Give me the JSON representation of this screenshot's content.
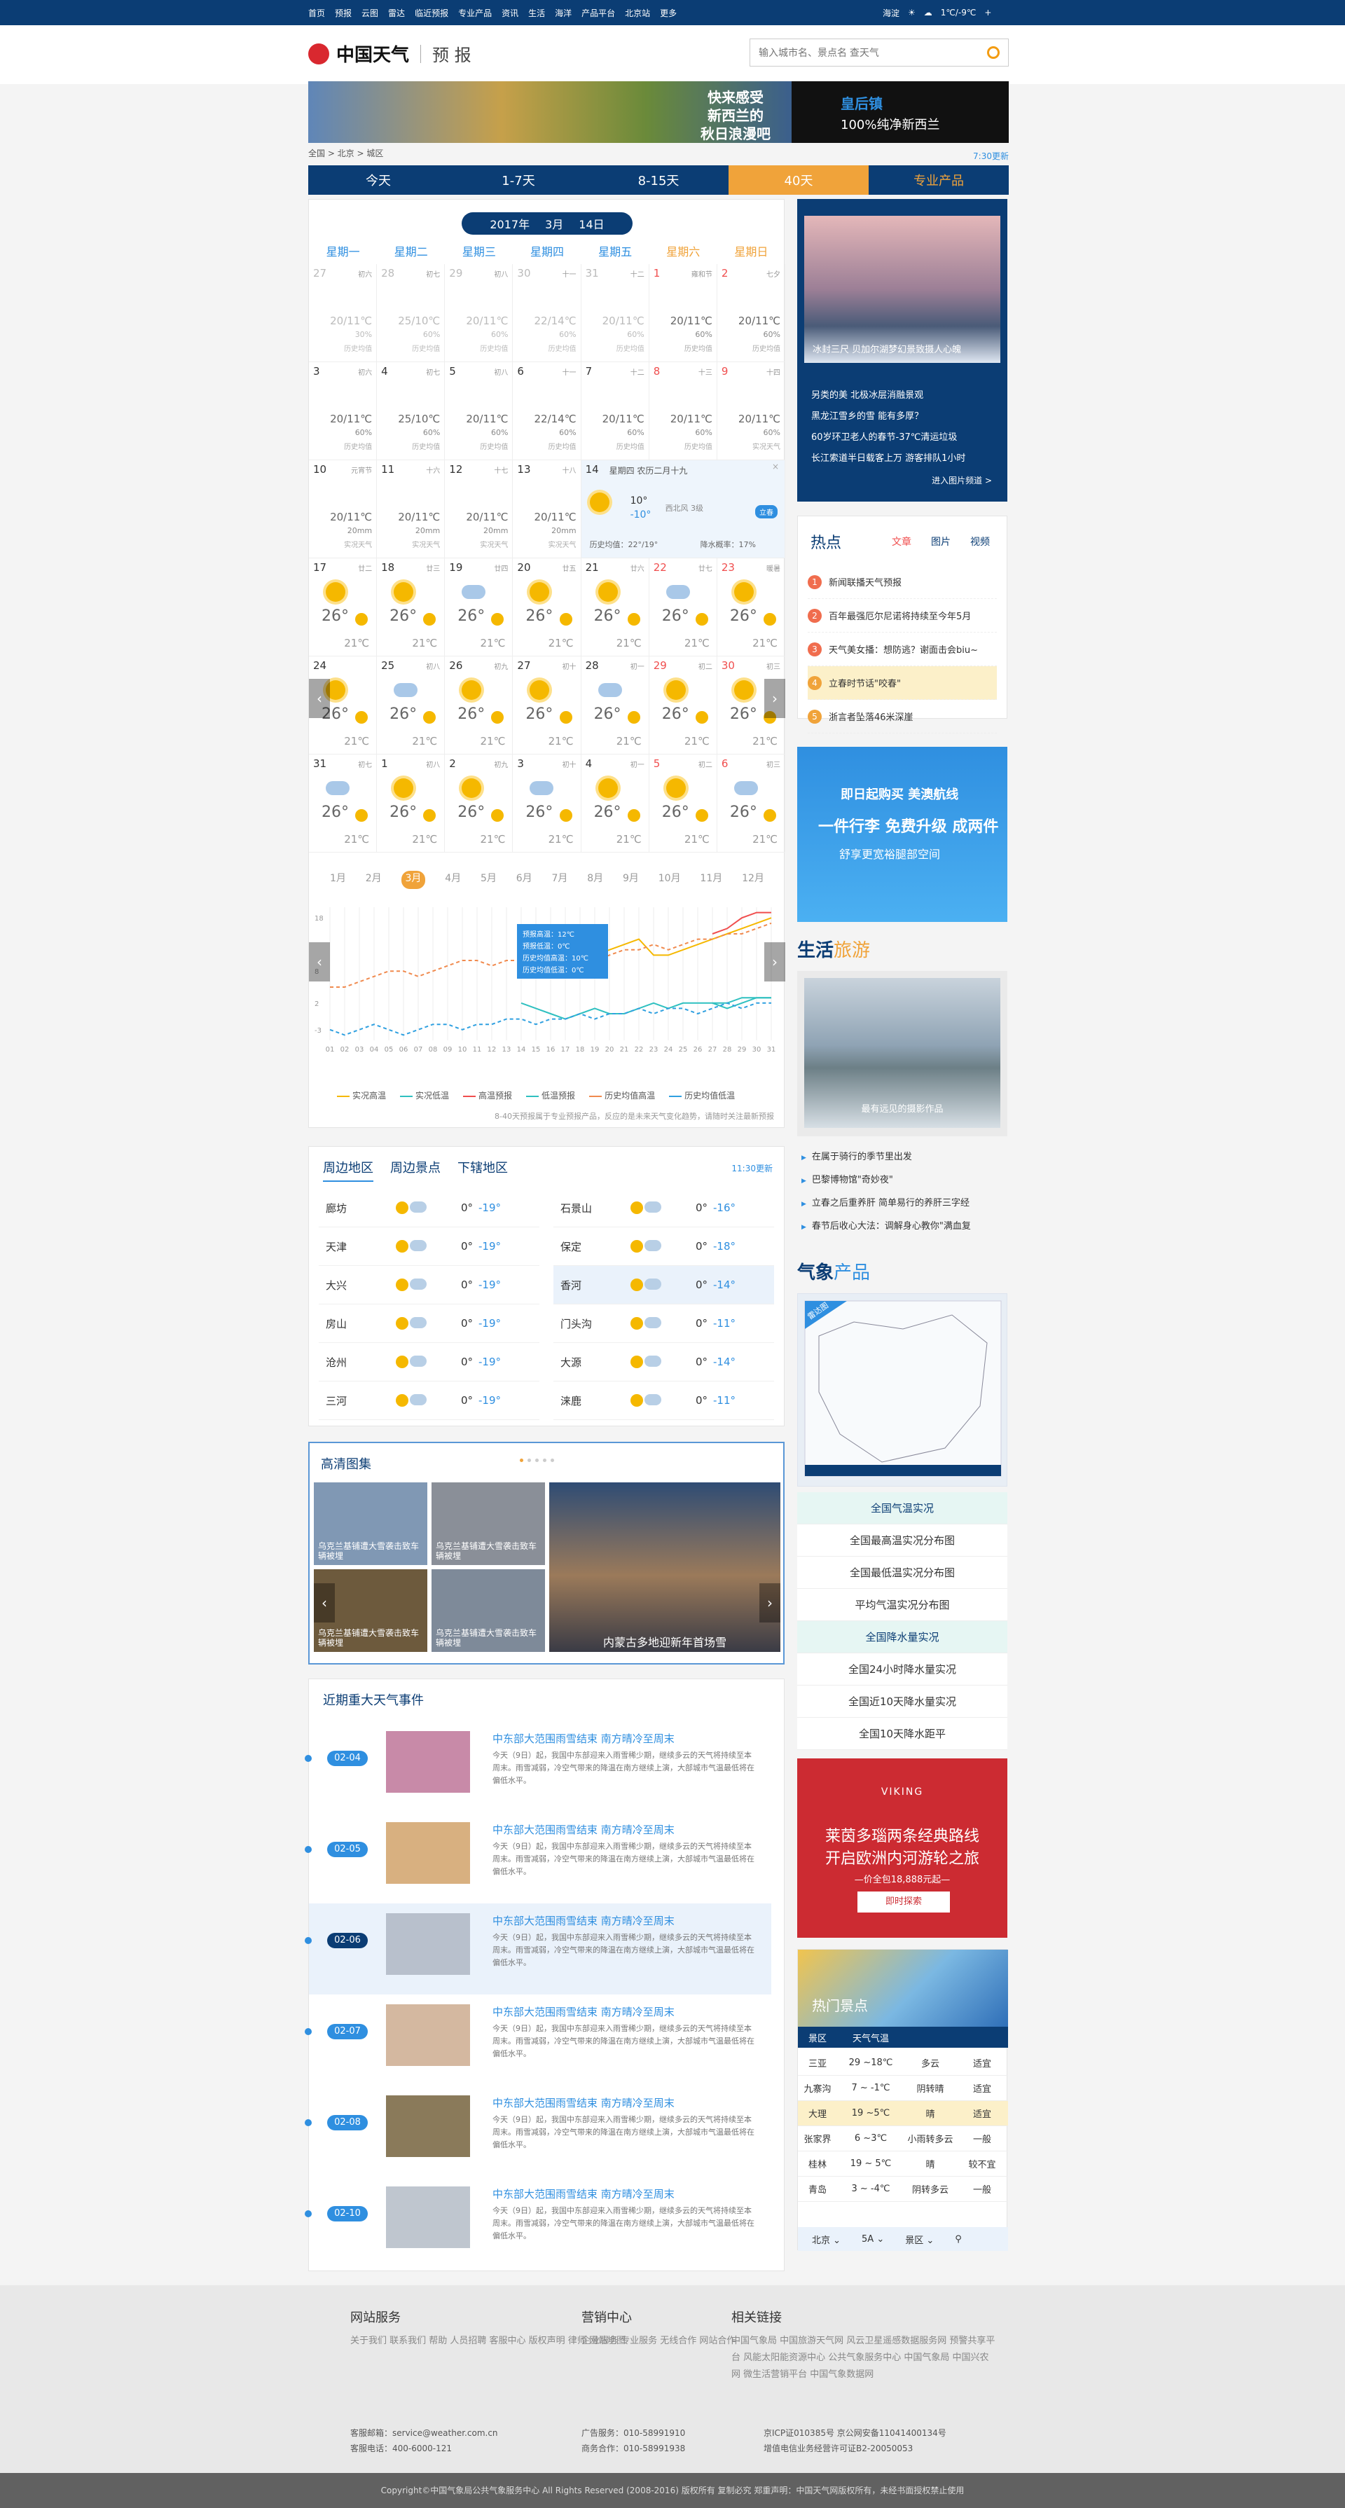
{
  "topbar": {
    "nav": [
      "首页",
      "预报",
      "云图",
      "雷达",
      "临近预报",
      "专业产品",
      "资讯",
      "生活",
      "海洋",
      "产品平台",
      "北京站",
      "更多"
    ],
    "city": "海淀",
    "temp": "1℃/-9℃"
  },
  "header": {
    "brand": "中国天气",
    "sub": "预 报",
    "search_placeholder": "输入城市名、景点名 查天气"
  },
  "banner": {
    "a": "快来感受\n新西兰的\n秋日浪漫吧",
    "b1": "皇后镇",
    "b2": "100%纯净新西兰"
  },
  "crumb": {
    "path": "全国 > 北京 > 城区",
    "time": "7:30更新"
  },
  "tabs": [
    "今天",
    "1-7天",
    "8-15天",
    "40天",
    "专业产品"
  ],
  "calendar": {
    "year": "2017年",
    "month": "3月",
    "day": "14日",
    "weekdays": [
      "星期一",
      "星期二",
      "星期三",
      "星期四",
      "星期五",
      "星期六",
      "星期日"
    ],
    "cells": [
      {
        "d": "27",
        "l": "初六",
        "t": "20/11℃",
        "p": "30%",
        "h": "历史均值",
        "prev": true
      },
      {
        "d": "28",
        "l": "初七",
        "t": "25/10℃",
        "p": "60%",
        "h": "历史均值",
        "prev": true
      },
      {
        "d": "29",
        "l": "初八",
        "t": "20/11℃",
        "p": "60%",
        "h": "历史均值",
        "prev": true
      },
      {
        "d": "30",
        "l": "十一",
        "t": "22/14℃",
        "p": "60%",
        "h": "历史均值",
        "prev": true
      },
      {
        "d": "31",
        "l": "十二",
        "t": "20/11℃",
        "p": "60%",
        "h": "历史均值",
        "prev": true
      },
      {
        "d": "1",
        "l": "雍和节",
        "t": "20/11℃",
        "p": "60%",
        "h": "历史均值"
      },
      {
        "d": "2",
        "l": "七夕",
        "t": "20/11℃",
        "p": "60%",
        "h": "历史均值"
      },
      {
        "d": "3",
        "l": "初六",
        "t": "20/11℃",
        "p": "60%",
        "h": "历史均值"
      },
      {
        "d": "4",
        "l": "初七",
        "t": "25/10℃",
        "p": "60%",
        "h": "历史均值"
      },
      {
        "d": "5",
        "l": "初八",
        "t": "20/11℃",
        "p": "60%",
        "h": "历史均值"
      },
      {
        "d": "6",
        "l": "十一",
        "t": "22/14℃",
        "p": "60%",
        "h": "历史均值"
      },
      {
        "d": "7",
        "l": "十二",
        "t": "20/11℃",
        "p": "60%",
        "h": "历史均值"
      },
      {
        "d": "8",
        "l": "十三",
        "t": "20/11℃",
        "p": "60%",
        "h": "历史均值"
      },
      {
        "d": "9",
        "l": "十四",
        "t": "20/11℃",
        "p": "60%",
        "h": "实况天气"
      },
      {
        "d": "10",
        "l": "元宵节",
        "t": "20/11℃",
        "p": "20mm",
        "h": "实况天气"
      },
      {
        "d": "11",
        "l": "十六",
        "t": "20/11℃",
        "p": "20mm",
        "h": "实况天气"
      },
      {
        "d": "12",
        "l": "十七",
        "t": "20/11℃",
        "p": "20mm",
        "h": "实况天气"
      },
      {
        "d": "13",
        "l": "十八",
        "t": "20/11℃",
        "p": "20mm",
        "h": "实况天气"
      },
      {
        "d": "14",
        "today": true
      },
      {
        "d": "17",
        "l": "廿二",
        "big": "26°",
        "lo": "21℃"
      },
      {
        "d": "18",
        "l": "廿三",
        "big": "26°",
        "lo": "21℃"
      },
      {
        "d": "19",
        "l": "廿四",
        "big": "26°",
        "lo": "21℃"
      },
      {
        "d": "20",
        "l": "廿五",
        "big": "26°",
        "lo": "21℃"
      },
      {
        "d": "21",
        "l": "廿六",
        "big": "26°",
        "lo": "21℃"
      },
      {
        "d": "22",
        "l": "廿七",
        "big": "26°",
        "lo": "21℃"
      },
      {
        "d": "23",
        "l": "暖暑",
        "big": "26°",
        "lo": "21℃"
      },
      {
        "d": "24",
        "l": "",
        "big": "26°",
        "lo": "21℃"
      },
      {
        "d": "25",
        "l": "初八",
        "big": "26°",
        "lo": "21℃"
      },
      {
        "d": "26",
        "l": "初九",
        "big": "26°",
        "lo": "21℃"
      },
      {
        "d": "27",
        "l": "初十",
        "big": "26°",
        "lo": "21℃"
      },
      {
        "d": "28",
        "l": "初一",
        "big": "26°",
        "lo": "21℃"
      },
      {
        "d": "29",
        "l": "初二",
        "big": "26°",
        "lo": "21℃"
      },
      {
        "d": "30",
        "l": "初三",
        "big": "26°",
        "lo": "21℃"
      },
      {
        "d": "31",
        "l": "初七",
        "big": "26°",
        "lo": "21℃"
      },
      {
        "d": "1",
        "l": "初八",
        "big": "26°",
        "lo": "21℃"
      },
      {
        "d": "2",
        "l": "初九",
        "big": "26°",
        "lo": "21℃"
      },
      {
        "d": "3",
        "l": "初十",
        "big": "26°",
        "lo": "21℃"
      },
      {
        "d": "4",
        "l": "初一",
        "big": "26°",
        "lo": "21℃"
      },
      {
        "d": "5",
        "l": "初二",
        "big": "26°",
        "lo": "21℃"
      },
      {
        "d": "6",
        "l": "初三",
        "big": "26°",
        "lo": "21℃"
      }
    ],
    "today": {
      "date": "14",
      "title": "星期四 农历二月十九",
      "hi": "10°",
      "lo": "-10°",
      "wind": "西北风 3级",
      "badge": "立春",
      "hist": "历史均值：22°/19°",
      "rain": "降水概率：17%"
    },
    "months": [
      "1月",
      "2月",
      "3月",
      "4月",
      "5月",
      "6月",
      "7月",
      "8月",
      "9月",
      "10月",
      "11月",
      "12月"
    ],
    "legend": [
      "实况高温",
      "实况低温",
      "高温预报",
      "低温预报",
      "历史均值高温",
      "历史均值低温"
    ],
    "note": "8-40天预报属于专业预报产品，反应的是未来天气变化趋势，请随时关注最新预报",
    "tooltip": [
      "预报高温：12℃",
      "预报低温：0℃",
      "历史均值高温：10℃",
      "历史均值低温：0℃"
    ]
  },
  "nearby": {
    "tabs": [
      "周边地区",
      "周边景点",
      "下辖地区"
    ],
    "time": "11:30更新",
    "rows": [
      {
        "n": "廊坊",
        "t": "0°",
        "t2": "-19°"
      },
      {
        "n": "石景山",
        "t": "0°",
        "t2": "-16°"
      },
      {
        "n": "天津",
        "t": "0°",
        "t2": "-19°"
      },
      {
        "n": "保定",
        "t": "0°",
        "t2": "-18°"
      },
      {
        "n": "大兴",
        "t": "0°",
        "t2": "-19°"
      },
      {
        "n": "香河",
        "t": "0°",
        "t2": "-14°"
      },
      {
        "n": "房山",
        "t": "0°",
        "t2": "-19°"
      },
      {
        "n": "门头沟",
        "t": "0°",
        "t2": "-11°"
      },
      {
        "n": "沧州",
        "t": "0°",
        "t2": "-19°"
      },
      {
        "n": "大源",
        "t": "0°",
        "t2": "-14°"
      },
      {
        "n": "三河",
        "t": "0°",
        "t2": "-19°"
      },
      {
        "n": "涞鹿",
        "t": "0°",
        "t2": "-11°"
      }
    ]
  },
  "gallery": {
    "title": "高清图集",
    "captions": [
      "乌克兰基铺遭大雪袭击致车辆被埋",
      "乌克兰基铺遭大雪袭击致车辆被埋",
      "乌克兰基铺遭大雪袭击致车辆被埋",
      "乌克兰基铺遭大雪袭击致车辆被埋",
      "内蒙古多地迎新年首场雪"
    ]
  },
  "events": {
    "title": "近期重大天气事件",
    "items": [
      {
        "date": "02-04",
        "h": "中东部大范围雨雪结束 南方晴冷至周末",
        "b": "今天（9日）起，我国中东部迎来入雨雪稀少期，继续多云的天气将持续至本周末。雨雪减弱，冷空气带来的降温在南方继续上演，大部城市气温最低将在偏低水平。"
      },
      {
        "date": "02-05",
        "h": "中东部大范围雨雪结束 南方晴冷至周末",
        "b": "今天（9日）起，我国中东部迎来入雨雪稀少期，继续多云的天气将持续至本周末。雨雪减弱，冷空气带来的降温在南方继续上演，大部城市气温最低将在偏低水平。"
      },
      {
        "date": "02-06",
        "h": "中东部大范围雨雪结束 南方晴冷至周末",
        "b": "今天（9日）起，我国中东部迎来入雨雪稀少期，继续多云的天气将持续至本周末。雨雪减弱，冷空气带来的降温在南方继续上演，大部城市气温最低将在偏低水平。"
      },
      {
        "date": "02-07",
        "h": "中东部大范围雨雪结束 南方晴冷至周末",
        "b": "今天（9日）起，我国中东部迎来入雨雪稀少期，继续多云的天气将持续至本周末。雨雪减弱，冷空气带来的降温在南方继续上演，大部城市气温最低将在偏低水平。"
      },
      {
        "date": "02-08",
        "h": "中东部大范围雨雪结束 南方晴冷至周末",
        "b": "今天（9日）起，我国中东部迎来入雨雪稀少期，继续多云的天气将持续至本周末。雨雪减弱，冷空气带来的降温在南方继续上演，大部城市气温最低将在偏低水平。"
      },
      {
        "date": "02-10",
        "h": "中东部大范围雨雪结束 南方晴冷至周末",
        "b": "今天（9日）起，我国中东部迎来入雨雪稀少期，继续多云的天气将持续至本周末。雨雪减弱，冷空气带来的降温在南方继续上演，大部城市气温最低将在偏低水平。"
      }
    ]
  },
  "side1": {
    "cap": "冰封三尺 贝加尔湖梦幻景致摄人心魄",
    "list": [
      "另类的美 北极冰层消融景观",
      "黑龙江雪乡的雪 能有多厚？",
      "60岁环卫老人的春节-37℃清运垃圾",
      "长江索道半日载客上万 游客排队1小时"
    ],
    "more": "进入图片频道 >"
  },
  "hot": {
    "title": "热点",
    "tabs": [
      "文章",
      "图片",
      "视频"
    ],
    "items": [
      "新闻联播天气预报",
      "百年最强厄尔尼诺将持续至今年5月",
      "天气美女播：想防逃？谢面击会biu~",
      "立春时节话\"咬春\"",
      "浙言者坠落46米深崖"
    ]
  },
  "ad1": {
    "t1": "即日起购买 美澳航线",
    "t2": "一件行李 免费升级 成两件",
    "t3": "舒享更宽裕腿部空间"
  },
  "life": {
    "a": "生活",
    "b": "旅游",
    "cap": "最有远见的摄影作品",
    "list": [
      "在属于骑行的季节里出发",
      "巴黎博物馆\"奇妙夜\"",
      "立春之后重养肝 简单易行的养肝三字经",
      "春节后收心大法：调解身心教你\"满血复"
    ]
  },
  "prod": {
    "a": "气象",
    "b": "产品",
    "radar": "雷达图",
    "list": [
      "全国气温实况",
      "全国最高温实况分布图",
      "全国最低温实况分布图",
      "平均气温实况分布图",
      "全国降水量实况",
      "全国24小时降水量实况",
      "全国近10天降水量实况",
      "全国10天降水距平"
    ]
  },
  "viking": {
    "brand": "VIKING",
    "text": "莱茵多瑙两条经典路线\n开启欧洲内河游轮之旅",
    "price": "—价全包18,888元起—",
    "btn": "即时探索"
  },
  "hotspots": {
    "title": "热门景点",
    "head": [
      "景区",
      "天气气温",
      "",
      ""
    ],
    "rows": [
      [
        "三亚",
        "29 ~18℃",
        "多云",
        "适宜"
      ],
      [
        "九寨沟",
        "7 ~ -1℃",
        "阴转晴",
        "适宜"
      ],
      [
        "大理",
        "19 ~5℃",
        "晴",
        "适宜"
      ],
      [
        "张家界",
        "6 ~3℃",
        "小雨转多云",
        "一般"
      ],
      [
        "桂林",
        "19 ~ 5℃",
        "晴",
        "较不宜"
      ],
      [
        "青岛",
        "3 ~ -4℃",
        "阴转多云",
        "一般"
      ]
    ],
    "sel": [
      "北京",
      "5A",
      "景区"
    ]
  },
  "footer": {
    "c1": {
      "h": "网站服务",
      "l": [
        "关于我们",
        "联系我们",
        "帮助",
        "人员招聘",
        "客服中心",
        "版权声明",
        "律师",
        "网站地图"
      ]
    },
    "c2": {
      "h": "营销中心",
      "l": [
        "企业服务",
        "专业服务",
        "无线合作",
        "网站合作"
      ]
    },
    "c3": {
      "h": "相关链接",
      "l": [
        "中国气象局",
        "中国旅游天气网",
        "风云卫星遥感数据服务网",
        "预警共享平台",
        "风能太阳能资源中心",
        "公共气象服务中心",
        "中国气象局",
        "中国兴农网",
        "微生活营销平台",
        "中国气象数据网"
      ]
    },
    "contact": [
      "客服邮箱：service@weather.com.cn",
      "客服电话：400-6000-121"
    ],
    "contact2": [
      "广告服务：010-58991910",
      "商务合作：010-58991938"
    ],
    "contact3": [
      "京ICP证010385号  京公网安备11041400134号",
      "增值电信业务经营许可证B2-20050053"
    ],
    "copy": "Copyright©中国气象局公共气象服务中心 All Rights Reserved (2008-2016) 版权所有 复制必究 郑重声明：中国天气网版权所有，未经书面授权禁止使用"
  },
  "chart_data": {
    "type": "line",
    "title": "",
    "x": [
      "01",
      "02",
      "03",
      "04",
      "05",
      "06",
      "07",
      "08",
      "09",
      "10",
      "11",
      "12",
      "13",
      "14",
      "15",
      "16",
      "17",
      "18",
      "19",
      "20",
      "21",
      "22",
      "23",
      "24",
      "25",
      "26",
      "27",
      "28",
      "29",
      "30",
      "31"
    ],
    "ylim": [
      -5,
      20
    ],
    "yticks": [
      18,
      8,
      2,
      -3
    ],
    "series": [
      {
        "name": "实况高温",
        "color": "#f5b800",
        "values": [
          null,
          null,
          null,
          null,
          null,
          null,
          null,
          null,
          null,
          null,
          null,
          null,
          null,
          14,
          12,
          11,
          10,
          10,
          11,
          12,
          13,
          14,
          11,
          11,
          12,
          13,
          14,
          15,
          16,
          17,
          18
        ]
      },
      {
        "name": "实况低温",
        "color": "#2fc0c0",
        "values": [
          null,
          null,
          null,
          null,
          null,
          null,
          null,
          null,
          null,
          null,
          null,
          null,
          null,
          2,
          1,
          0,
          -1,
          0,
          1,
          0,
          0,
          1,
          2,
          1,
          2,
          2,
          2,
          1,
          2,
          3,
          3
        ]
      },
      {
        "name": "高温预报",
        "color": "#f04e4e",
        "values": [
          null,
          null,
          null,
          null,
          null,
          null,
          null,
          null,
          null,
          null,
          null,
          null,
          null,
          null,
          null,
          null,
          null,
          null,
          null,
          null,
          null,
          null,
          null,
          null,
          null,
          null,
          15,
          16,
          18,
          19,
          19
        ]
      },
      {
        "name": "低温预报",
        "color": "#2fc0c0",
        "values": [
          null,
          null,
          null,
          null,
          null,
          null,
          null,
          null,
          null,
          null,
          null,
          null,
          null,
          null,
          null,
          null,
          null,
          null,
          null,
          null,
          null,
          null,
          null,
          null,
          null,
          null,
          2,
          2,
          3,
          3,
          3
        ]
      },
      {
        "name": "历史均值高温",
        "color": "#f08a4e",
        "dash": true,
        "values": [
          5,
          5,
          6,
          7,
          8,
          8,
          7,
          8,
          9,
          10,
          10,
          9,
          10,
          10,
          9,
          10,
          10,
          11,
          10,
          11,
          12,
          12,
          13,
          12,
          13,
          14,
          14,
          15,
          15,
          16,
          17
        ]
      },
      {
        "name": "历史均值低温",
        "color": "#2fa0e0",
        "dash": true,
        "values": [
          -3,
          -4,
          -3,
          -2,
          -3,
          -4,
          -3,
          -2,
          -2,
          -3,
          -2,
          -2,
          -1,
          -1,
          -2,
          -1,
          -1,
          0,
          -1,
          0,
          0,
          1,
          0,
          1,
          1,
          0,
          1,
          2,
          1,
          2,
          2
        ]
      }
    ]
  }
}
